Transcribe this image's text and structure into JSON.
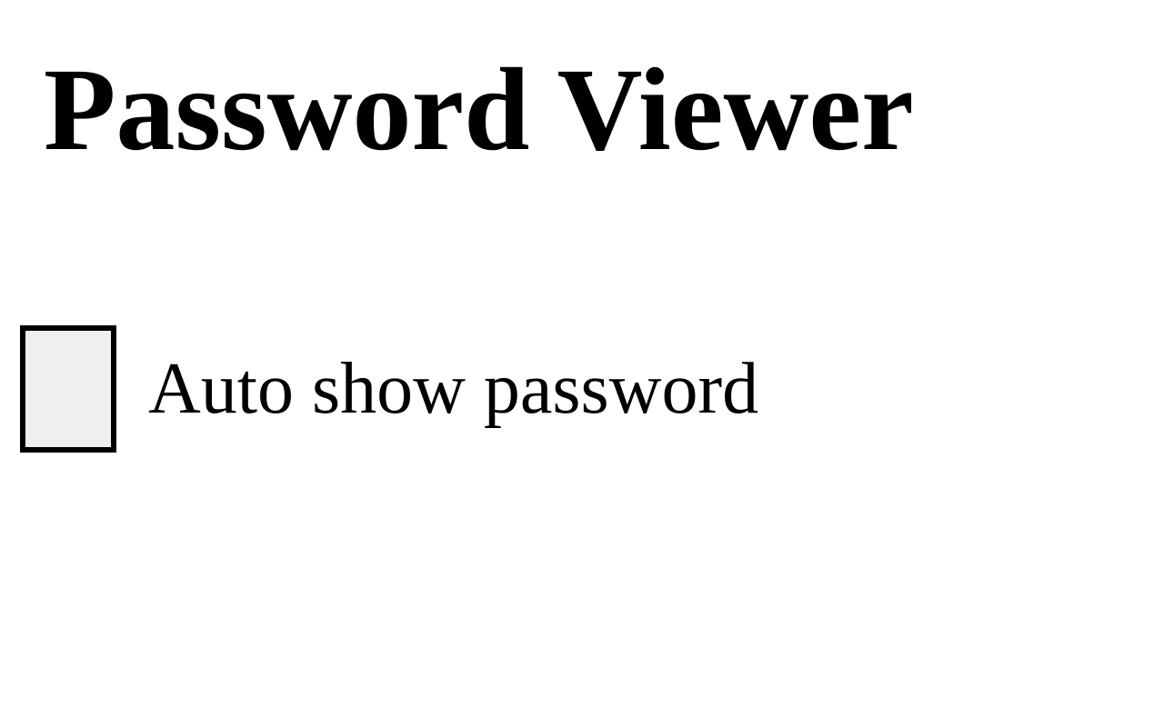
{
  "header": {
    "title": "Password Viewer"
  },
  "options": {
    "auto_show_password": {
      "label": "Auto show password",
      "checked": false
    }
  }
}
